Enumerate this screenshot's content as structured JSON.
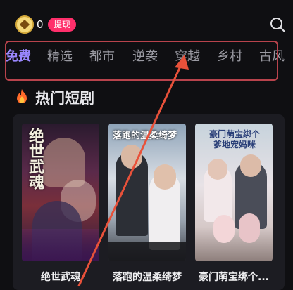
{
  "header": {
    "coin_count": "0",
    "withdraw_label": "提现"
  },
  "tabs": [
    {
      "label": "免费",
      "active": true
    },
    {
      "label": "精选",
      "active": false
    },
    {
      "label": "都市",
      "active": false
    },
    {
      "label": "逆袭",
      "active": false
    },
    {
      "label": "穿越",
      "active": false
    },
    {
      "label": "乡村",
      "active": false
    },
    {
      "label": "古风",
      "active": false
    }
  ],
  "section": {
    "title": "热门短剧",
    "icon": "fire-icon"
  },
  "dramas": [
    {
      "title": "绝世武魂",
      "poster_text": "绝世武魂"
    },
    {
      "title": "落跑的温柔绮梦",
      "poster_text": "落跑的温柔绮梦"
    },
    {
      "title": "豪门萌宝绑个...",
      "poster_text": "豪门萌宝绑个爹地宠妈咪"
    }
  ],
  "colors": {
    "accent_tab": "#9a87ff",
    "withdraw": "#ff2f6b",
    "annotation": "#e8513a"
  }
}
